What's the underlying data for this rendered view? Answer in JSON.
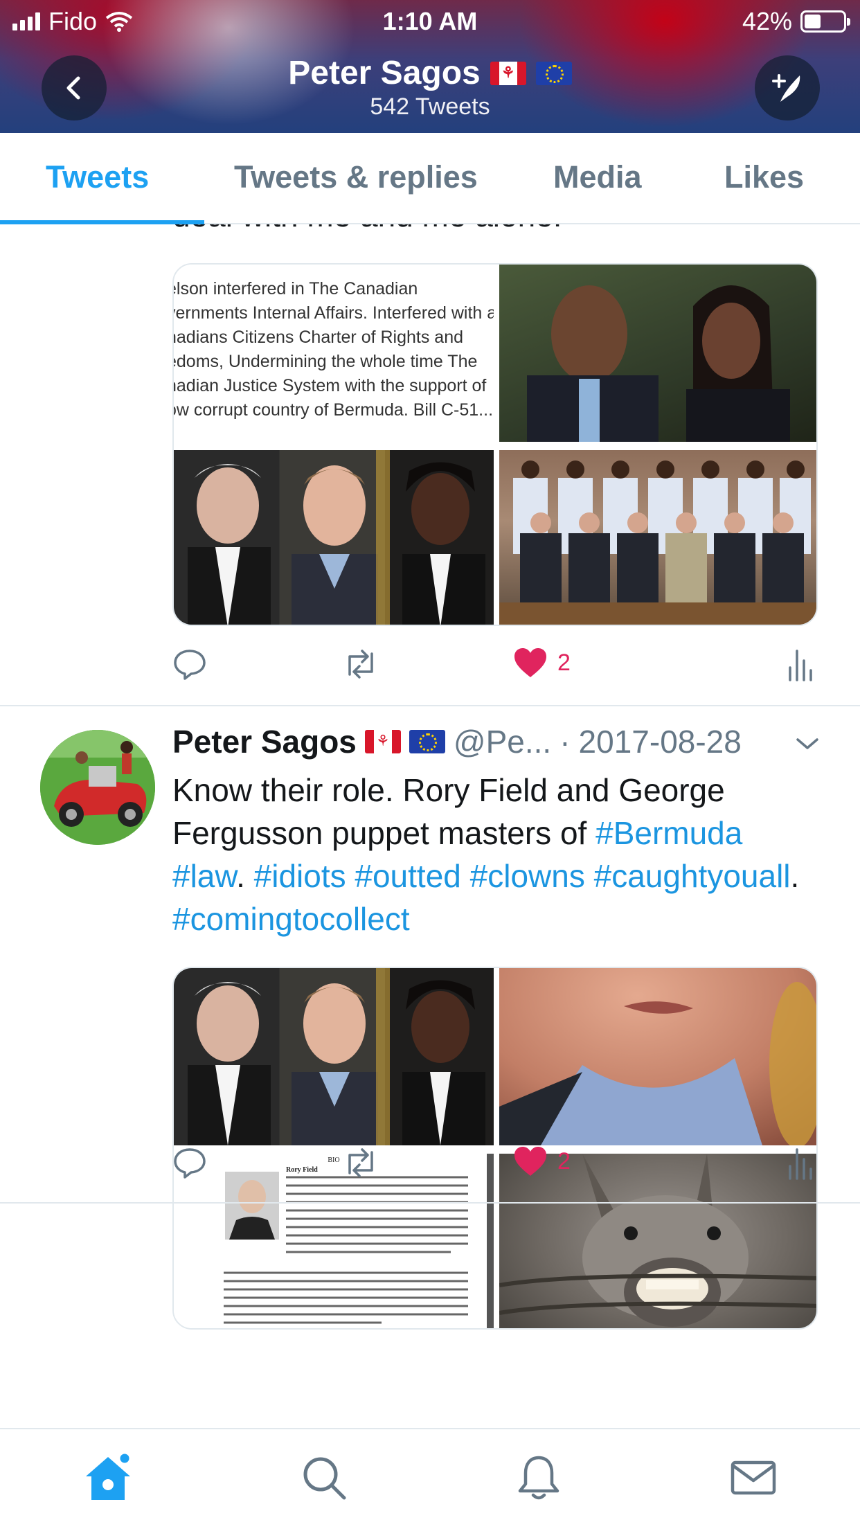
{
  "status_bar": {
    "carrier": "Fido",
    "time": "1:10 AM",
    "battery": "42%",
    "battery_level": 0.42
  },
  "header": {
    "name": "Peter Sagos",
    "tweet_count": "542 Tweets",
    "back_icon": "chevron-left-icon",
    "compose_icon": "compose-feather-icon"
  },
  "tabs": [
    {
      "label": "Tweets",
      "active": true
    },
    {
      "label": "Tweets & replies",
      "active": false
    },
    {
      "label": "Media",
      "active": false
    },
    {
      "label": "Likes",
      "active": false
    }
  ],
  "tweets": [
    {
      "cut_text": "deal with me and me alone.",
      "image_text": [
        "elson interfered in The Canadian",
        "vernments Internal Affairs. Interfered with a",
        "nadians Citizens Charter of Rights and",
        "edoms, Undermining the whole time The",
        "nadian Justice System with the support of",
        "ow corrupt country of Bermuda. Bill C-51..."
      ],
      "likes": "2"
    },
    {
      "author": "Peter Sagos",
      "handle": "@Pe...",
      "separator": "·",
      "date": "2017-08-28",
      "text_parts": [
        {
          "text": "Know their role. Rory Field and George Fergusson puppet masters of ",
          "hashtag": false
        },
        {
          "text": "#Bermuda",
          "hashtag": true
        },
        {
          "text": " ",
          "hashtag": false
        },
        {
          "text": "#law",
          "hashtag": true
        },
        {
          "text": ". ",
          "hashtag": false
        },
        {
          "text": "#idiots",
          "hashtag": true
        },
        {
          "text": " ",
          "hashtag": false
        },
        {
          "text": "#outted",
          "hashtag": true
        },
        {
          "text": " ",
          "hashtag": false
        },
        {
          "text": "#clowns",
          "hashtag": true
        },
        {
          "text": " ",
          "hashtag": false
        },
        {
          "text": "#caughtyouall",
          "hashtag": true
        },
        {
          "text": ". ",
          "hashtag": false
        },
        {
          "text": "#comingtocollect",
          "hashtag": true
        }
      ],
      "doc_title": "BIO",
      "doc_name": "Rory Field",
      "likes": "2"
    }
  ],
  "bottom_nav": [
    {
      "name": "home",
      "icon": "home-icon",
      "active": true
    },
    {
      "name": "search",
      "icon": "search-icon",
      "active": false
    },
    {
      "name": "notifications",
      "icon": "bell-icon",
      "active": false
    },
    {
      "name": "messages",
      "icon": "mail-icon",
      "active": false
    }
  ],
  "colors": {
    "accent": "#1da1f2",
    "hashtag": "#1b95e0",
    "like": "#e0245e",
    "muted": "#657786"
  }
}
